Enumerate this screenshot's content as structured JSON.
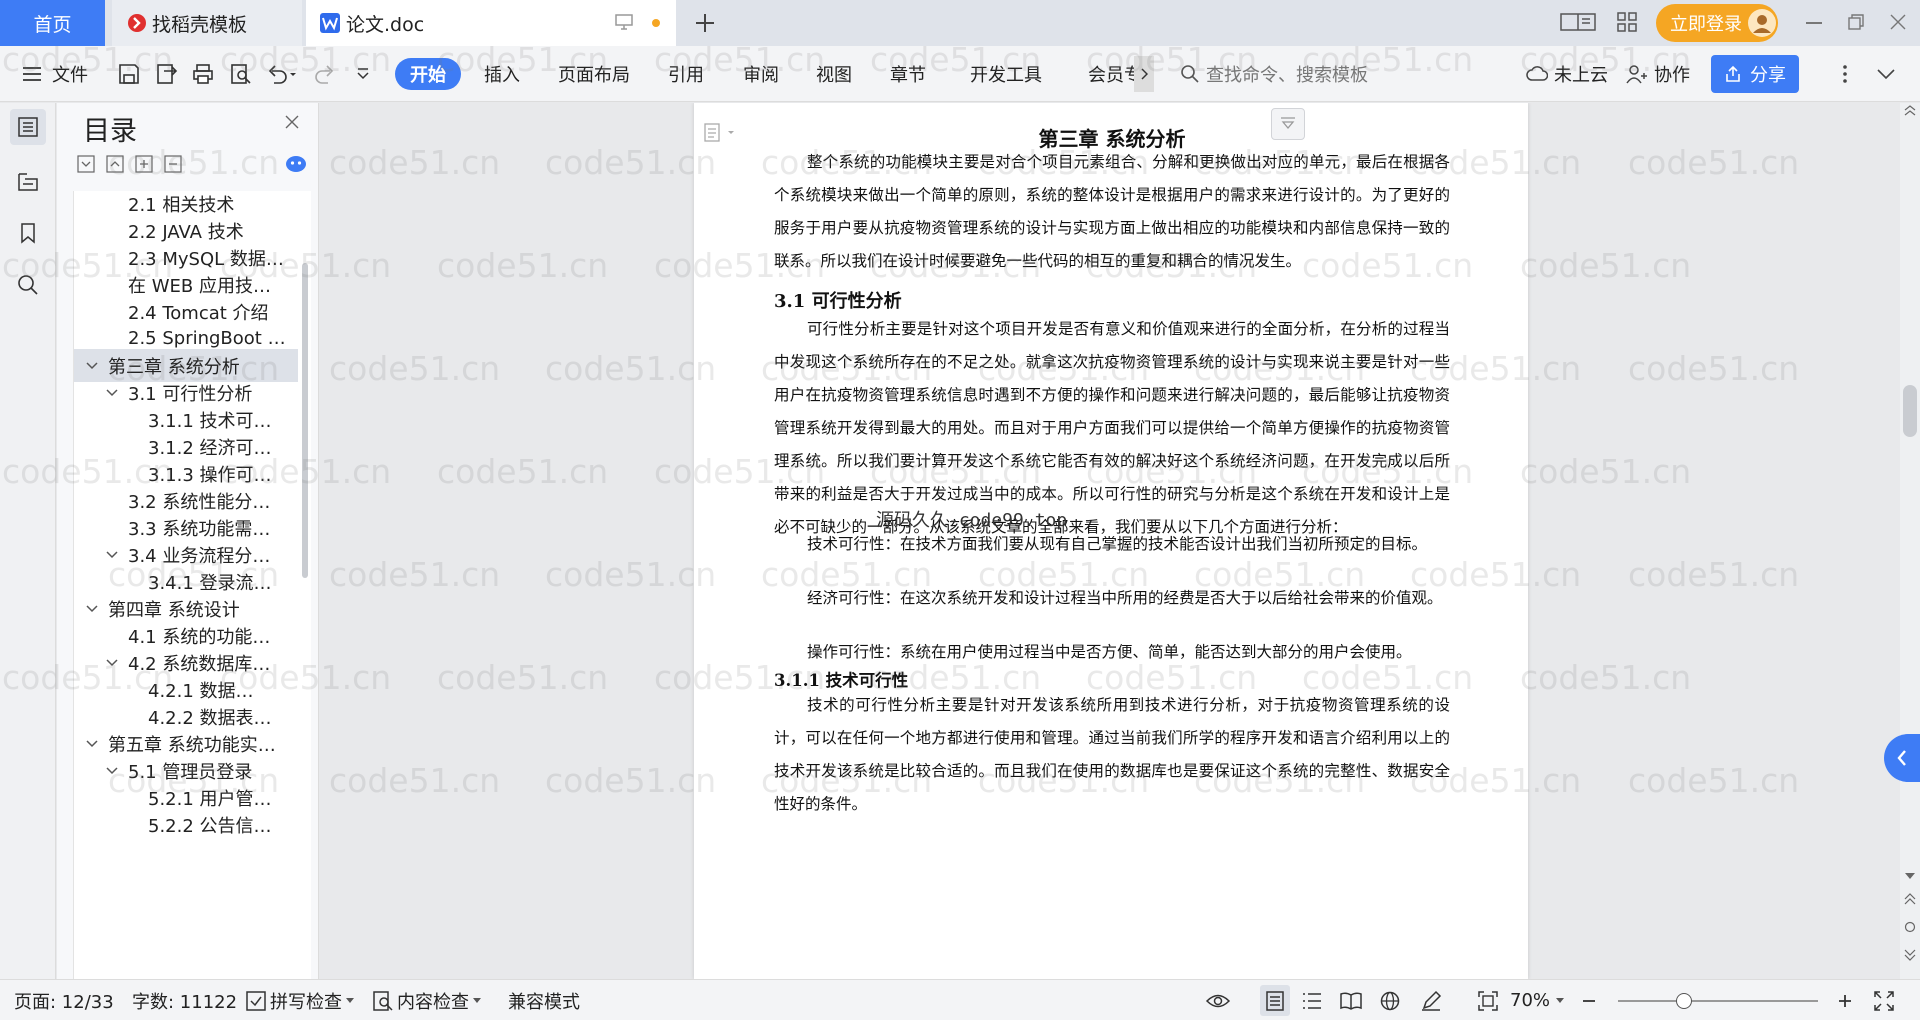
{
  "tabs": {
    "home": "首页",
    "template": "找稻壳模板",
    "document": "论文.doc"
  },
  "top_right": {
    "login": "立即登录"
  },
  "toolbar": {
    "file": "文件",
    "ribbon_tabs": [
      "开始",
      "插入",
      "页面布局",
      "引用",
      "审阅",
      "视图",
      "章节",
      "开发工具",
      "会员专"
    ],
    "search_placeholder": "查找命令、搜索模板",
    "cloud": "未上云",
    "collab": "协作",
    "share": "分享"
  },
  "toc": {
    "title": "目录",
    "items": [
      {
        "label": "2.1 相关技术",
        "level": 2,
        "expander": false
      },
      {
        "label": "2.2 JAVA 技术",
        "level": 2,
        "expander": false
      },
      {
        "label": "2.3 MySQL 数据…",
        "level": 2,
        "expander": false
      },
      {
        "label": "在 WEB 应用技…",
        "level": 2,
        "expander": false
      },
      {
        "label": "2.4 Tomcat 介绍",
        "level": 2,
        "expander": false
      },
      {
        "label": "2.5 SpringBoot …",
        "level": 2,
        "expander": false
      },
      {
        "label": "第三章  系统分析",
        "level": 1,
        "expander": true,
        "selected": true
      },
      {
        "label": "3.1  可行性分析",
        "level": 2,
        "expander": true
      },
      {
        "label": "3.1.1   技术可…",
        "level": 3,
        "expander": false
      },
      {
        "label": "3.1.2  经济可…",
        "level": 3,
        "expander": false
      },
      {
        "label": "3.1.3  操作可…",
        "level": 3,
        "expander": false
      },
      {
        "label": "3.2  系统性能分…",
        "level": 2,
        "expander": false
      },
      {
        "label": "3.3  系统功能需…",
        "level": 2,
        "expander": false
      },
      {
        "label": "3.4  业务流程分…",
        "level": 2,
        "expander": true
      },
      {
        "label": "3.4.1 登录流…",
        "level": 3,
        "expander": false
      },
      {
        "label": "第四章  系统设计",
        "level": 1,
        "expander": true
      },
      {
        "label": "4.1  系统的功能…",
        "level": 2,
        "expander": false
      },
      {
        "label": "4.2  系统数据库…",
        "level": 2,
        "expander": true
      },
      {
        "label": "4.2.1    数据…",
        "level": 3,
        "expander": false
      },
      {
        "label": "4.2.2    数据表…",
        "level": 3,
        "expander": false
      },
      {
        "label": "第五章  系统功能实…",
        "level": 1,
        "expander": true
      },
      {
        "label": "5.1 管理员登录",
        "level": 2,
        "expander": true
      },
      {
        "label": "5.2.1  用户管…",
        "level": 3,
        "expander": false
      },
      {
        "label": "5.2.2  公告信…",
        "level": 3,
        "expander": false
      }
    ]
  },
  "document": {
    "chapter_title": "第三章  系统分析",
    "intro": "整个系统的功能模块主要是对合个项目元素组合、分解和更换做出对应的单元，最后在根据各个系统模块来做出一个简单的原则，系统的整体设计是根据用户的需求来进行设计的。为了更好的服务于用户要从抗疫物资管理系统的设计与实现方面上做出相应的功能模块和内部信息保持一致的联系。所以我们在设计时候要避免一些代码的相互的重复和耦合的情况发生。",
    "section_31": "3.1  可行性分析",
    "para_31": "可行性分析主要是针对这个项目开发是否有意义和价值观来进行的全面分析，在分析的过程当中发现这个系统所存在的不足之处。就拿这次抗疫物资管理系统的设计与实现来说主要是针对一些用户在抗疫物资管理系统信息时遇到不方便的操作和问题来进行解决问题的，最后能够让抗疫物资管理系统开发得到最大的用处。而且对于用户方面我们可以提供给一个简单方便操作的抗疫物资管理系统。所以我们要计算开发这个系统它能否有效的解决好这个系统经济问题，在开发完成以后所带来的利益是否大于开发过成当中的成本。所以可行性的研究与分析是这个系统在开发和设计上是必不可缺少的一部分。从该系统文章的全部来看，我们要从以下几个方面进行分析：",
    "tech": "技术可行性：在技术方面我们要从现有自己掌握的技术能否设计出我们当初所预定的目标。",
    "econ": "经济可行性：在这次系统开发和设计过程当中所用的经费是否大于以后给社会带来的价值观。",
    "oper": "操作可行性：系统在用户使用过程当中是否方便、简单，能否达到大部分的用户会使用。",
    "section_311": "3.1.1   技术可行性",
    "para_311": "技术的可行性分析主要是针对开发该系统所用到技术进行分析，对于抗疫物资管理系统的设计，可以在任何一个地方都进行使用和管理。通过当前我们所学的程序开发和语言介绍利用以上的技术开发该系统是比较合适的。而且我们在使用的数据库也是要保证这个系统的完整性、数据安全性好的条件。",
    "center_watermark": "源码久久-code99.top",
    "watermark": "code51.cn"
  },
  "status": {
    "page": "页面: 12/33",
    "words": "字数: 11122",
    "spell": "拼写检查",
    "content_check": "内容检查",
    "compat": "兼容模式",
    "zoom": "70%"
  },
  "colors": {
    "accent": "#3e7cf5",
    "login": "#f5a623"
  }
}
